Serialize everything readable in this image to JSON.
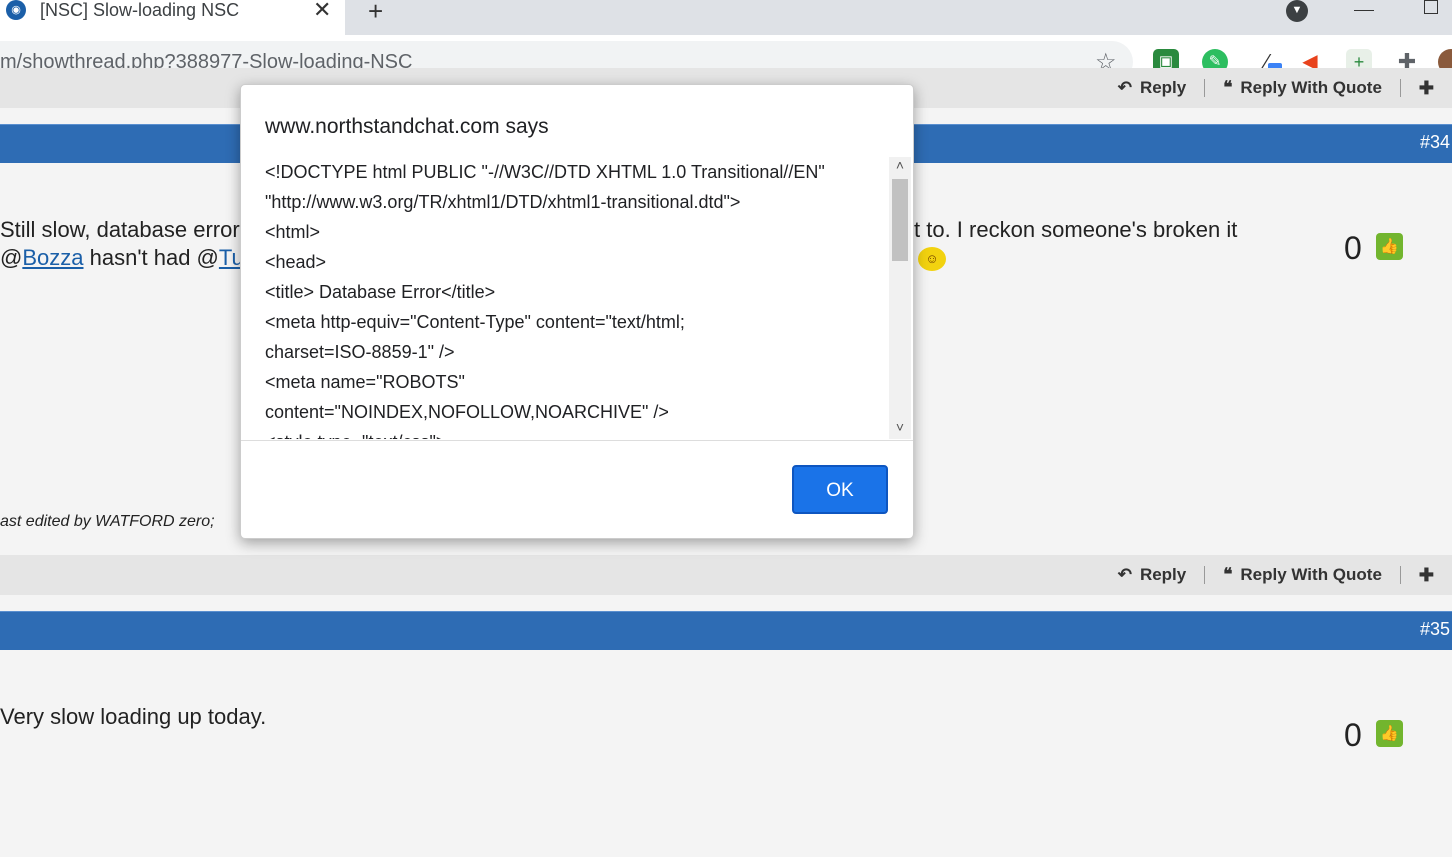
{
  "browser": {
    "tab": {
      "title": "[NSC] Slow-loading NSC",
      "close_label": "✕",
      "favicon": "site-crest-icon"
    },
    "new_tab_label": "+",
    "url": "m/showthread.php?388977-Slow-loading-NSC",
    "extensions": [
      "qr-reader-icon",
      "evernote-icon",
      "color-picker-icon",
      "megaphone-icon",
      "add-tab-icon",
      "puzzle-icon",
      "profile-avatar"
    ]
  },
  "posts": {
    "post34": {
      "number": "#34",
      "line1_start": "Still slow, database error",
      "line1_end": "t to. I reckon someone's broken it",
      "line2_at1": "@",
      "line2_link1": "Bozza",
      "line2_mid": " hasn't had @",
      "line2_link2": "Tu",
      "likes": "0",
      "edited": "ast edited by WATFORD zero;"
    },
    "post35": {
      "number": "#35",
      "text": "Very slow loading up today.",
      "likes": "0"
    }
  },
  "actions": {
    "reply": "Reply",
    "reply_with_quote": "Reply With Quote"
  },
  "dialog": {
    "title": "www.northstandchat.com says",
    "lines": [
      "<!DOCTYPE html PUBLIC \"-//W3C//DTD XHTML 1.0 Transitional//EN\"",
      "\"http://www.w3.org/TR/xhtml1/DTD/xhtml1-transitional.dtd\">",
      "<html>",
      "<head>",
      "<title> Database Error</title>",
      "<meta http-equiv=\"Content-Type\" content=\"text/html;",
      "charset=ISO-8859-1\" />",
      "<meta name=\"ROBOTS\"",
      "content=\"NOINDEX,NOFOLLOW,NOARCHIVE\" />",
      "<style type=\"text/css\">"
    ],
    "ok_label": "OK"
  },
  "colors": {
    "post_bar": "#2e6cb4",
    "like": "#72b52e",
    "ok_button": "#1a73e8"
  }
}
